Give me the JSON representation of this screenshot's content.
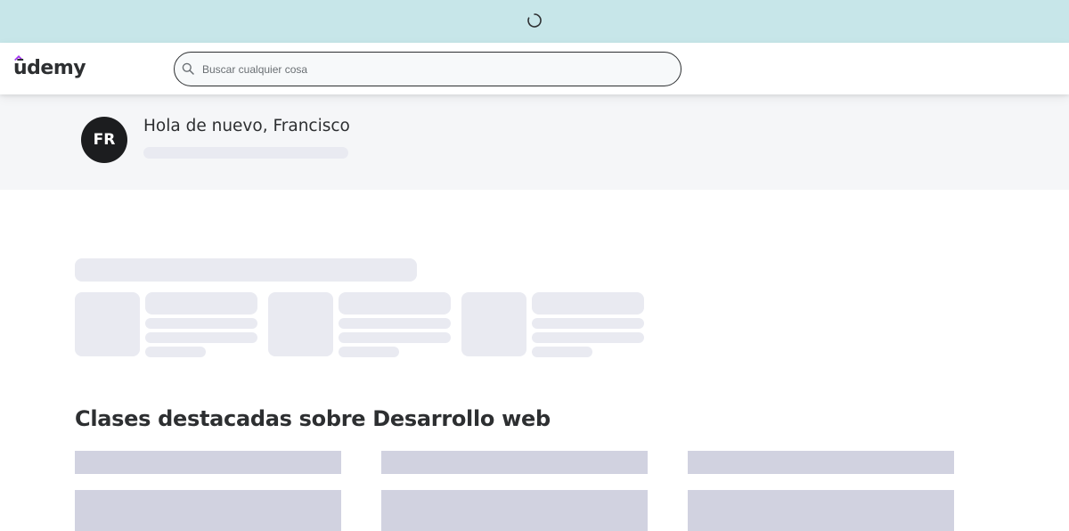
{
  "loading": {
    "spinner_icon": "loading-spinner-icon"
  },
  "header": {
    "logo_text": "ūdemy",
    "search": {
      "placeholder": "Buscar cualquier cosa",
      "value": "",
      "icon": "search-icon"
    }
  },
  "welcome": {
    "avatar_initials": "FR",
    "greeting": "Hola de nuevo, Francisco"
  },
  "featured": {
    "title": "Clases destacadas sobre Desarrollo web"
  },
  "colors": {
    "loading_bar": "#c7e6e9",
    "header_bg": "#ffffff",
    "welcome_bg": "#f5f6f8",
    "skeleton_light": "#e9eaf1",
    "skeleton_dark": "#d1d2e0",
    "avatar_bg": "#1c1d1f",
    "text": "#2d2f31",
    "brand_purple": "#a435f0"
  }
}
